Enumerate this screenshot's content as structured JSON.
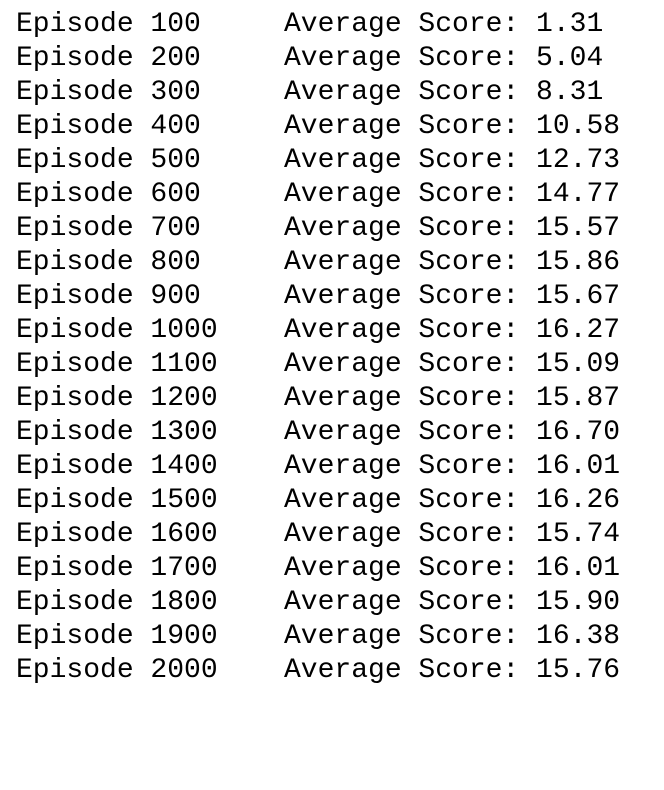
{
  "log": {
    "lines": [
      {
        "episode": "Episode 100",
        "score": "Average Score: 1.31"
      },
      {
        "episode": "Episode 200",
        "score": "Average Score: 5.04"
      },
      {
        "episode": "Episode 300",
        "score": "Average Score: 8.31"
      },
      {
        "episode": "Episode 400",
        "score": "Average Score: 10.58"
      },
      {
        "episode": "Episode 500",
        "score": "Average Score: 12.73"
      },
      {
        "episode": "Episode 600",
        "score": "Average Score: 14.77"
      },
      {
        "episode": "Episode 700",
        "score": "Average Score: 15.57"
      },
      {
        "episode": "Episode 800",
        "score": "Average Score: 15.86"
      },
      {
        "episode": "Episode 900",
        "score": "Average Score: 15.67"
      },
      {
        "episode": "Episode 1000",
        "score": "Average Score: 16.27"
      },
      {
        "episode": "Episode 1100",
        "score": "Average Score: 15.09"
      },
      {
        "episode": "Episode 1200",
        "score": "Average Score: 15.87"
      },
      {
        "episode": "Episode 1300",
        "score": "Average Score: 16.70"
      },
      {
        "episode": "Episode 1400",
        "score": "Average Score: 16.01"
      },
      {
        "episode": "Episode 1500",
        "score": "Average Score: 16.26"
      },
      {
        "episode": "Episode 1600",
        "score": "Average Score: 15.74"
      },
      {
        "episode": "Episode 1700",
        "score": "Average Score: 16.01"
      },
      {
        "episode": "Episode 1800",
        "score": "Average Score: 15.90"
      },
      {
        "episode": "Episode 1900",
        "score": "Average Score: 16.38"
      },
      {
        "episode": "Episode 2000",
        "score": "Average Score: 15.76"
      }
    ]
  }
}
